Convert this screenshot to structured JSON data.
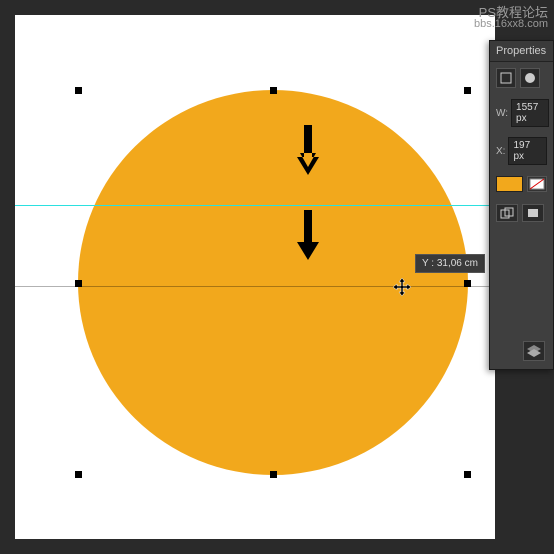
{
  "watermark": {
    "text": "PS教程论坛",
    "url": "bbs.16xx8.com"
  },
  "tooltip": {
    "label": "Y : 31,06 cm"
  },
  "properties": {
    "title": "Properties",
    "w_label": "W:",
    "w_value": "1557 px",
    "x_label": "X:",
    "x_value": "197 px",
    "fill_color": "#f2a81c"
  },
  "shape": {
    "fill": "#f2a81c"
  },
  "icons": {
    "bounding": "bounding-box-icon",
    "mask": "mask-icon",
    "layers": "layers-icon",
    "align_box": "align-box-icon"
  }
}
